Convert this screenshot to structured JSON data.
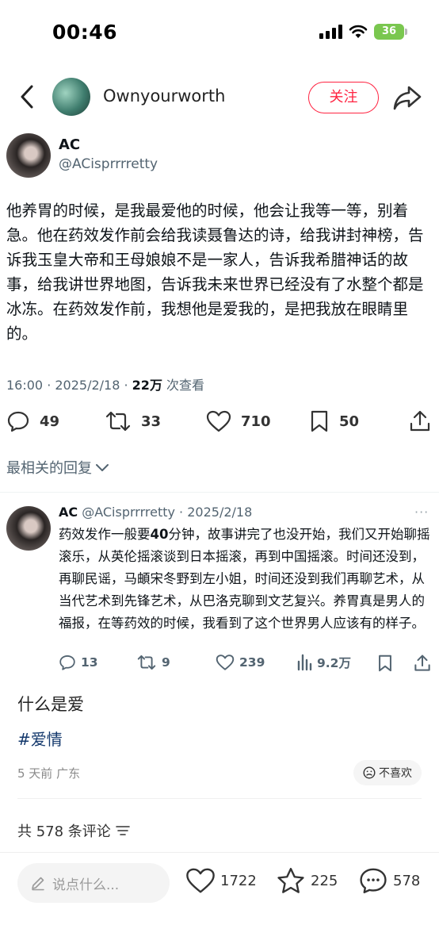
{
  "status_bar": {
    "time": "00:46",
    "battery": "36"
  },
  "nav": {
    "author": "Ownyourworth",
    "follow_label": "关注"
  },
  "tweet": {
    "name": "AC",
    "handle": "@ACisprrrretty",
    "body": "他养胃的时候，是我最爱他的时候，他会让我等一等，别着急。他在药效发作前会给我读聂鲁达的诗，给我讲封神榜，告诉我玉皇大帝和王母娘娘不是一家人，告诉我希腊神话的故事，给我讲世界地图，告诉我未来世界已经没有了水整个都是冰冻。在药效发作前，我想他是爱我的，是把我放在眼睛里的。",
    "time": "16:00 · 2025/2/18 · ",
    "views": "22万",
    "views_label": " 次查看",
    "replies": "49",
    "retweets": "33",
    "likes": "710",
    "bookmarks": "50",
    "related_label": "最相关的回复"
  },
  "reply": {
    "name": "AC",
    "handle_date": " @ACisprrrretty · 2025/2/18",
    "more": "···",
    "body_1": "药效发作一般要",
    "body_bold": "40",
    "body_2": "分钟，故事讲完了也没开始，我们又开始聊摇滚乐，从英伦摇滚谈到日本摇滚，再到中国摇滚。时间还没到，再聊民谣，马頔宋冬野到左小姐，时间还没到我们再聊艺术，从当代艺术到先锋艺术，从巴洛克聊到文艺复兴。养胃真是男人的福报，在等药效的时候，我看到了这个世界男人应该有的样子。",
    "replies": "13",
    "retweets": "9",
    "likes": "239",
    "views": "9.2万"
  },
  "post": {
    "title": "什么是爱",
    "tag": "#爱情",
    "time_location": "5 天前  广东",
    "dislike_label": "不喜欢",
    "comment_count_label": "共 578 条评论"
  },
  "bottom_bar": {
    "input_placeholder": "说点什么...",
    "likes": "1722",
    "collects": "225",
    "comments": "578"
  }
}
